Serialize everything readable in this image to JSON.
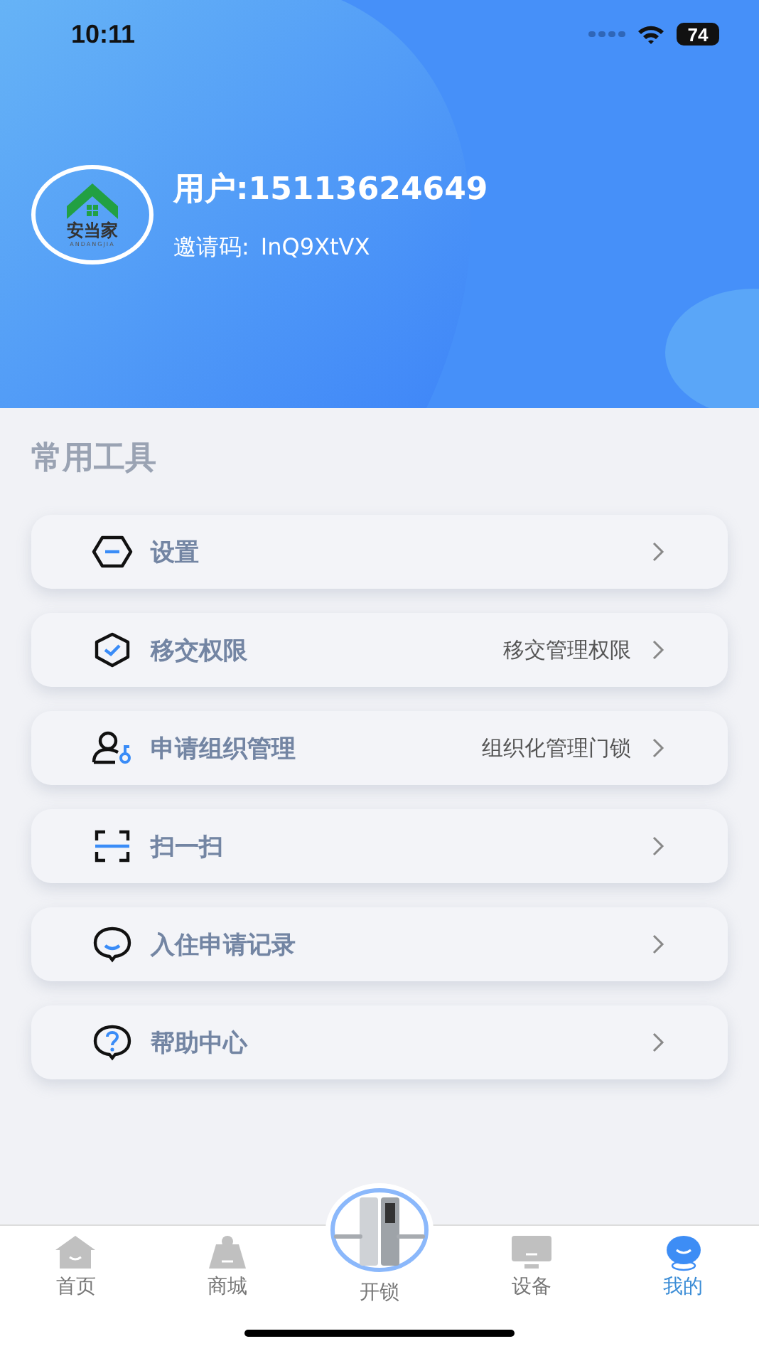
{
  "status_bar": {
    "time": "10:11",
    "battery": "74"
  },
  "profile": {
    "logo_name": "安当家",
    "logo_subtitle": "ANDANGJIA",
    "user": "用户:15113624649",
    "invite_label": "邀请码:",
    "invite_code": "InQ9XtVX"
  },
  "section_title": "常用工具",
  "menu": [
    {
      "kind": "settings",
      "label": "设置"
    },
    {
      "kind": "shield",
      "label": "移交权限",
      "detail": "移交管理权限"
    },
    {
      "kind": "user-key",
      "label": "申请组织管理",
      "detail": "组织化管理门锁"
    },
    {
      "kind": "scan",
      "label": "扫一扫"
    },
    {
      "kind": "chat",
      "label": "入住申请记录"
    },
    {
      "kind": "help",
      "label": "帮助中心"
    }
  ],
  "tabs": [
    {
      "kind": "home",
      "label": "首页",
      "selected": false
    },
    {
      "kind": "shop",
      "label": "商城",
      "selected": false
    },
    {
      "kind": "lock",
      "label": "开锁",
      "selected": false
    },
    {
      "kind": "device",
      "label": "设备",
      "selected": false
    },
    {
      "kind": "me",
      "label": "我的",
      "selected": true
    }
  ]
}
